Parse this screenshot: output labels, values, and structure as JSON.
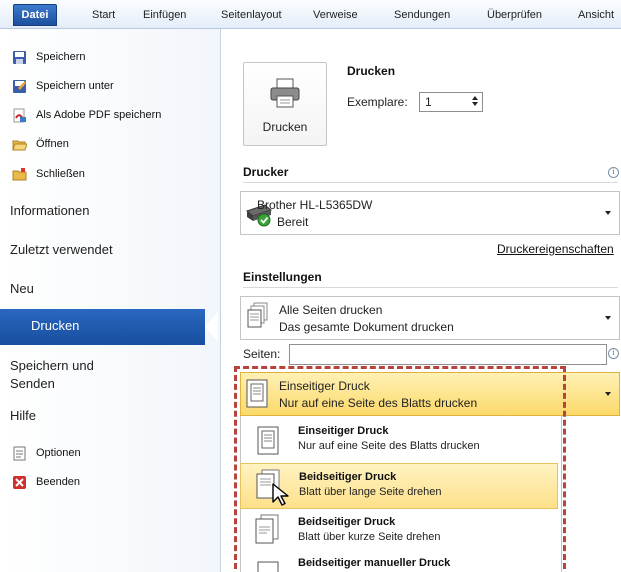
{
  "ribbon": {
    "tabs": [
      "Datei",
      "Start",
      "Einfügen",
      "Seitenlayout",
      "Verweise",
      "Sendungen",
      "Überprüfen",
      "Ansicht"
    ]
  },
  "nav": {
    "save": "Speichern",
    "save_as": "Speichern unter",
    "save_pdf": "Als Adobe PDF speichern",
    "open": "Öffnen",
    "close": "Schließen",
    "info": "Informationen",
    "recent": "Zuletzt verwendet",
    "new": "Neu",
    "print": "Drucken",
    "save_send": "Speichern und\nSenden",
    "help": "Hilfe",
    "options": "Optionen",
    "exit": "Beenden"
  },
  "print": {
    "button_label": "Drucken",
    "heading": "Drucken",
    "copies_label": "Exemplare:",
    "copies_value": "1"
  },
  "printer": {
    "section_title": "Drucker",
    "name": "Brother HL-L5365DW",
    "status": "Bereit",
    "properties_link": "Druckereigenschaften"
  },
  "settings": {
    "section_title": "Einstellungen",
    "pages_option_title": "Alle Seiten drucken",
    "pages_option_desc": "Das gesamte Dokument drucken",
    "pages_label": "Seiten:",
    "pages_value": "",
    "duplex_selected_title": "Einseitiger Druck",
    "duplex_selected_desc": "Nur auf eine Seite des Blatts drucken",
    "options": [
      {
        "title": "Einseitiger Druck",
        "desc": "Nur auf eine Seite des Blatts drucken"
      },
      {
        "title": "Beidseitiger Druck",
        "desc": "Blatt über lange Seite drehen"
      },
      {
        "title": "Beidseitiger Druck",
        "desc": "Blatt über kurze Seite drehen"
      },
      {
        "title": "Beidseitiger manueller Druck",
        "desc": ""
      }
    ]
  },
  "colors": {
    "accent_blue": "#1c4f9f",
    "highlight": "#fde58a",
    "annotation_red": "#b7423e"
  }
}
